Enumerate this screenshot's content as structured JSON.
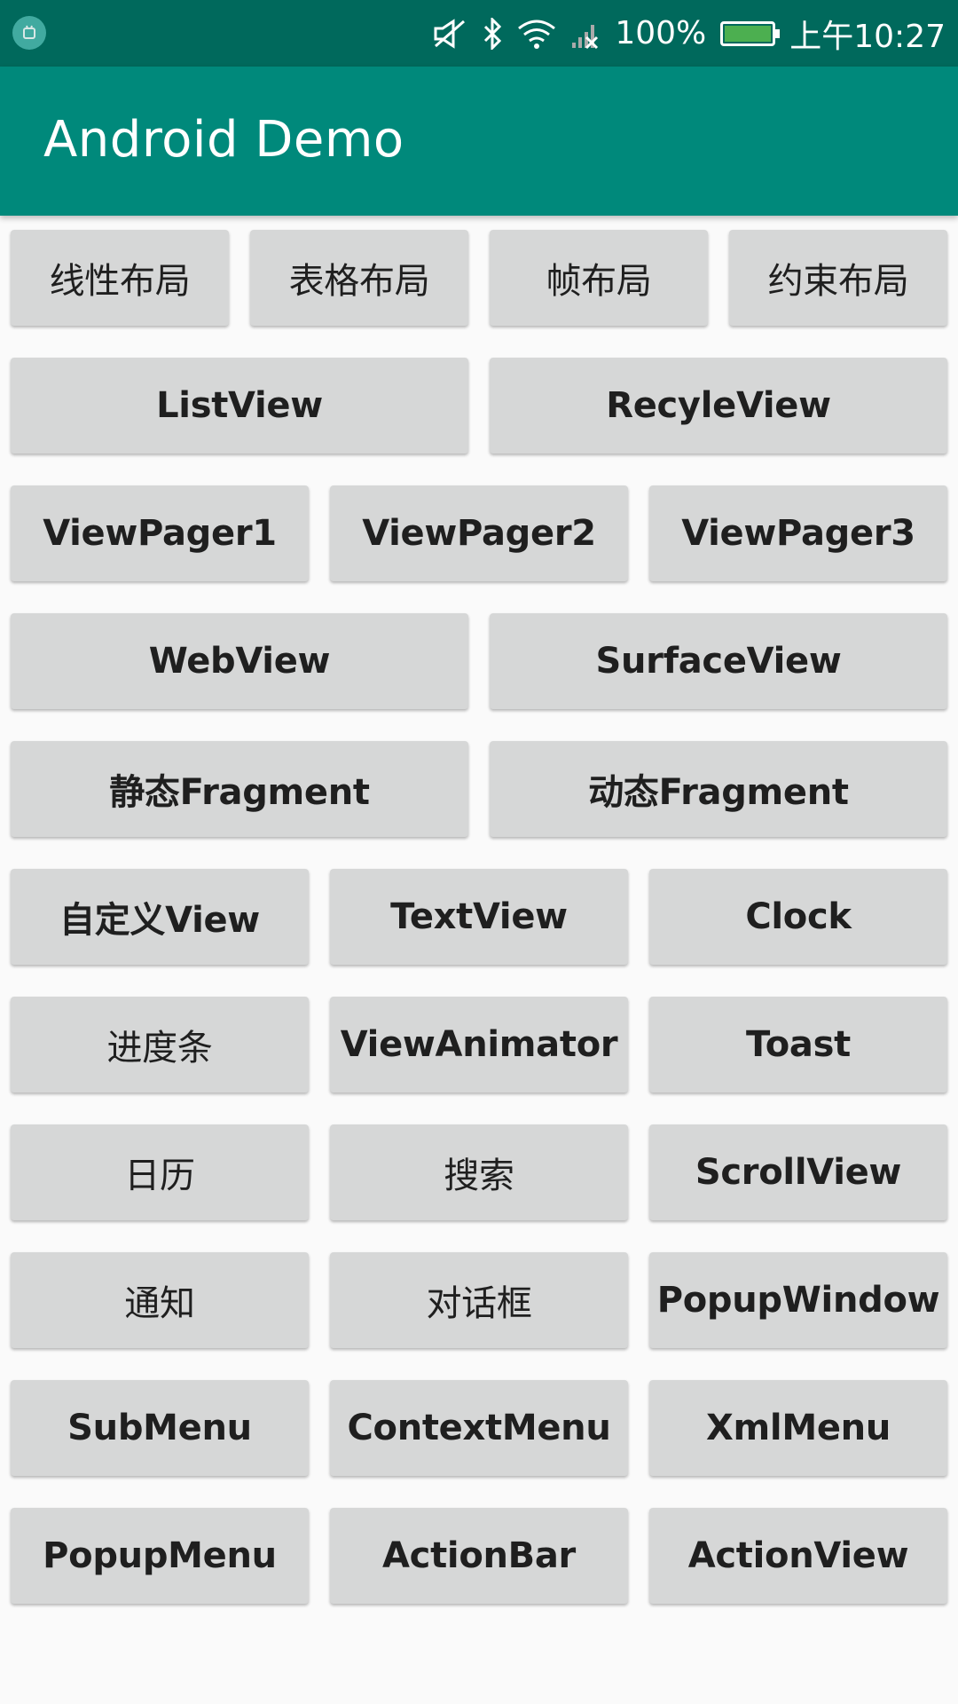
{
  "status_bar": {
    "left_icon": "android-debug-icon",
    "icons": [
      "mute-icon",
      "bluetooth-icon",
      "wifi-icon",
      "no-signal-icon"
    ],
    "battery_percent": "100%",
    "battery_level": 1.0,
    "time": "上午10:27"
  },
  "app_bar": {
    "title": "Android Demo"
  },
  "rows": [
    {
      "buttons": [
        "线性布局",
        "表格布局",
        "帧布局",
        "约束布局"
      ]
    },
    {
      "buttons": [
        "ListView",
        "RecyleView"
      ]
    },
    {
      "buttons": [
        "ViewPager1",
        "ViewPager2",
        "ViewPager3"
      ]
    },
    {
      "buttons": [
        "WebView",
        "SurfaceView"
      ]
    },
    {
      "buttons": [
        "静态Fragment",
        "动态Fragment"
      ]
    },
    {
      "buttons": [
        "自定义View",
        "TextView",
        "Clock"
      ]
    },
    {
      "buttons": [
        "进度条",
        "ViewAnimator",
        "Toast"
      ]
    },
    {
      "buttons": [
        "日历",
        "搜索",
        "ScrollView"
      ]
    },
    {
      "buttons": [
        "通知",
        "对话框",
        "PopupWindow"
      ]
    },
    {
      "buttons": [
        "SubMenu",
        "ContextMenu",
        "XmlMenu"
      ]
    },
    {
      "buttons": [
        "PopupMenu",
        "ActionBar",
        "ActionView"
      ]
    }
  ],
  "colors": {
    "status_bar": "#00695c",
    "app_bar": "#00897b",
    "button_bg": "#d6d7d7",
    "background": "#fafafa"
  }
}
